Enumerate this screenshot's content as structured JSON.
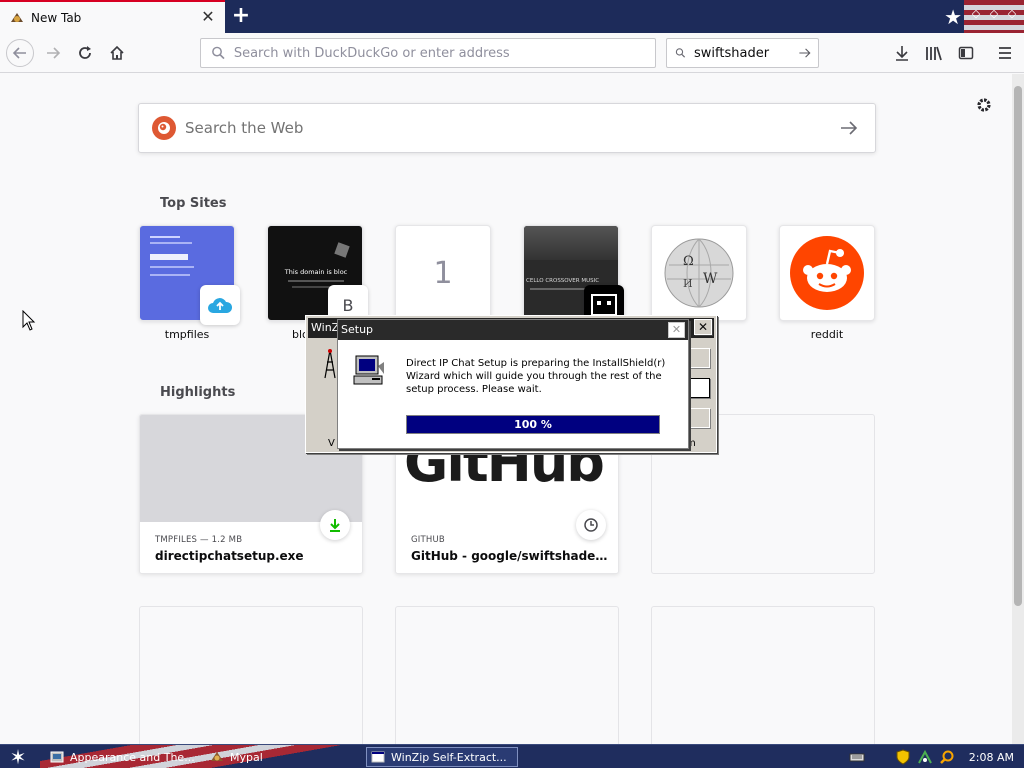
{
  "browser": {
    "tab": {
      "title": "New Tab"
    },
    "urlbar": {
      "placeholder": "Search with DuckDuckGo or enter address"
    },
    "searchbar": {
      "value": "swiftshader"
    }
  },
  "newtab": {
    "search": {
      "placeholder": "Search the Web"
    },
    "top_sites_title": "Top Sites",
    "top_sites": [
      {
        "label": "tmpfiles",
        "thumb_color": "#5a6be0"
      },
      {
        "label": "blocked.",
        "thumb_color": "#111111",
        "thumb_text": "This domain is bloc"
      },
      {
        "label": "",
        "tile_text": "1"
      },
      {
        "label": "",
        "thumb_color": "#3a3a3a",
        "thumb_text": "CELLO CROSSOVER MUSIC"
      },
      {
        "label": "",
        "icon": "wikipedia-globe"
      },
      {
        "label": "reddit",
        "icon": "reddit-alien"
      }
    ],
    "highlights_title": "Highlights",
    "highlights": [
      {
        "meta": "TMPFILES — 1.2 MB",
        "title": "directipchatsetup.exe",
        "icon": "download-icon"
      },
      {
        "meta": "GITHUB",
        "title": "GitHub - google/swiftshader: S...",
        "preview_text": "GitHub",
        "icon": "clock-icon"
      }
    ]
  },
  "dialogs": {
    "winzip": {
      "title": "WinZi",
      "frag_left": "V",
      "frag_right": "m"
    },
    "setup": {
      "title": "Setup",
      "message": "Direct IP Chat Setup is preparing the InstallShield(r) Wizard which will guide you through the rest of the setup process.  Please wait.",
      "progress_label": "100 %",
      "progress": 1.0
    }
  },
  "taskbar": {
    "items": [
      {
        "label": "Appearance and The..."
      },
      {
        "label": "Mypal"
      },
      {
        "label": "WinZip Self-Extract..."
      }
    ],
    "clock": "2:08 AM"
  },
  "colors": {
    "tab_accent": "#d70022",
    "ddg_orange": "#de5833",
    "reddit_orange": "#ff4500",
    "progress_navy": "#000080",
    "download_green": "#12bc00"
  }
}
